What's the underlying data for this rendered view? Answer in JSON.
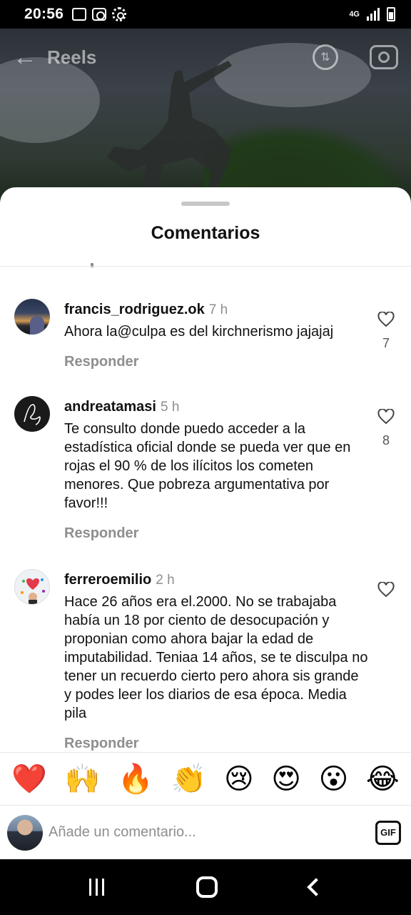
{
  "status_bar": {
    "time": "20:56",
    "network": "4G",
    "icons": [
      "sim-icon",
      "media-icon",
      "settings-gear-icon",
      "signal-icon",
      "battery-charging-icon"
    ]
  },
  "video_header": {
    "title": "Reels",
    "icons": [
      "back-arrow-icon",
      "swap-icon",
      "camera-icon"
    ]
  },
  "sheet": {
    "title": "Comentarios"
  },
  "comments": [
    {
      "username": "francis_rodriguez.ok",
      "time": "7 h",
      "text": "Ahora la@culpa es del kirchnerismo jajajaj",
      "reply_label": "Responder",
      "likes": "7"
    },
    {
      "username": "andreatamasi",
      "time": "5 h",
      "text": "Te consulto donde puedo acceder a la estadística oficial donde se pueda ver que en rojas el 90 % de los ilícitos los cometen menores.  Que pobreza argumentativa por favor!!!",
      "reply_label": "Responder",
      "likes": "8"
    },
    {
      "username": "ferreroemilio",
      "time": "2 h",
      "text": "Hace 26 años era el.2000. No se trabajaba había un 18 por ciento de desocupación y proponian como ahora bajar la edad de imputabilidad. Teniaa 14 años, se te disculpa no tener un recuerdo cierto pero ahora sis grande y podes leer los diarios de esa época. Media pila",
      "reply_label": "Responder",
      "likes": ""
    }
  ],
  "emoji_reactions": [
    "❤️",
    "🙌",
    "🔥",
    "👏",
    "😢",
    "😍",
    "😮",
    "😂"
  ],
  "composer": {
    "placeholder": "Añade un comentario...",
    "gif_label": "GIF"
  }
}
